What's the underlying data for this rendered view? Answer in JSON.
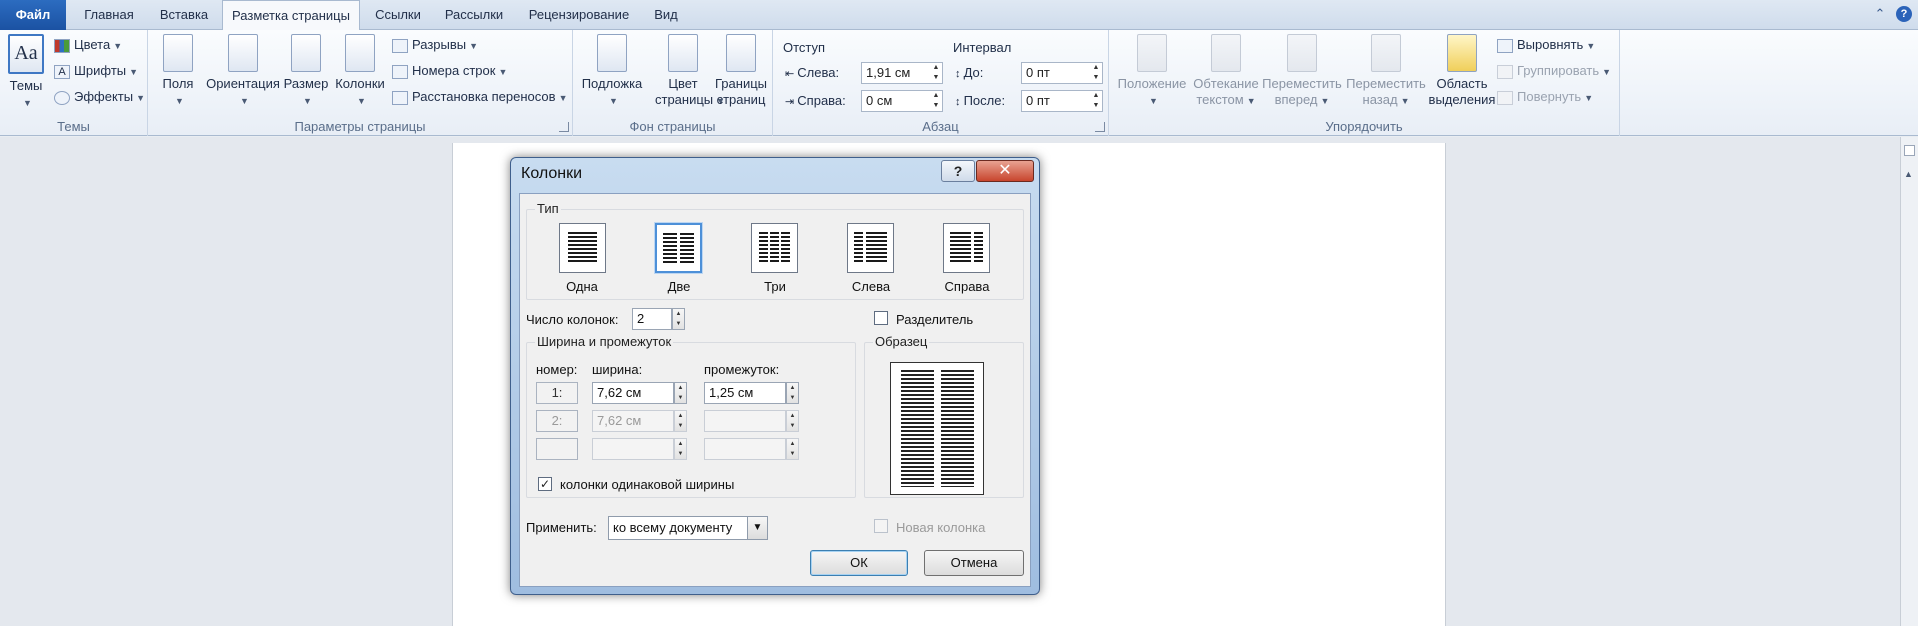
{
  "tabs": [
    {
      "label": "Файл"
    },
    {
      "label": "Главная"
    },
    {
      "label": "Вставка"
    },
    {
      "label": "Разметка страницы"
    },
    {
      "label": "Ссылки"
    },
    {
      "label": "Рассылки"
    },
    {
      "label": "Рецензирование"
    },
    {
      "label": "Вид"
    }
  ],
  "ribbon": {
    "themes": {
      "label": "Темы",
      "big": "Темы",
      "colors": "Цвета",
      "fonts": "Шрифты",
      "effects": "Эффекты"
    },
    "page_setup": {
      "label": "Параметры страницы",
      "margins": "Поля",
      "orientation": "Ориентация",
      "size": "Размер",
      "columns": "Колонки",
      "breaks": "Разрывы",
      "line_numbers": "Номера строк",
      "hyphenation": "Расстановка переносов"
    },
    "page_background": {
      "label": "Фон страницы",
      "watermark": "Подложка",
      "page_color_1": "Цвет",
      "page_color_2": "страницы",
      "borders_1": "Границы",
      "borders_2": "страниц"
    },
    "paragraph": {
      "label": "Абзац",
      "indent": "Отступ",
      "left_label": "Слева:",
      "left_value": "1,91 см",
      "right_label": "Справа:",
      "right_value": "0 см",
      "spacing": "Интервал",
      "before_label": "До:",
      "before_value": "0 пт",
      "after_label": "После:",
      "after_value": "0 пт"
    },
    "arrange": {
      "label": "Упорядочить",
      "position": "Положение",
      "wrap_1": "Обтекание",
      "wrap_2": "текстом",
      "forward_1": "Переместить",
      "forward_2": "вперед",
      "backward_1": "Переместить",
      "backward_2": "назад",
      "selection_1": "Область",
      "selection_2": "выделения",
      "align": "Выровнять",
      "group": "Группировать",
      "rotate": "Повернуть"
    }
  },
  "dialog": {
    "title": "Колонки",
    "help": "?",
    "close": "✕",
    "presets_legend": "Тип",
    "presets": [
      {
        "label": "Одна"
      },
      {
        "label": "Две"
      },
      {
        "label": "Три"
      },
      {
        "label": "Слева"
      },
      {
        "label": "Справа"
      }
    ],
    "num_columns_label": "Число колонок:",
    "num_columns_value": "2",
    "separator_label": "Разделитель",
    "width_spacing_legend": "Ширина и промежуток",
    "col_header_number": "номер:",
    "col_header_width": "ширина:",
    "col_header_spacing": "промежуток:",
    "rows": [
      {
        "number": "1:",
        "width": "7,62 см",
        "spacing": "1,25 см"
      },
      {
        "number": "2:",
        "width": "7,62 см",
        "spacing": ""
      },
      {
        "number": "",
        "width": "",
        "spacing": ""
      }
    ],
    "equal_width_label": "колонки одинаковой ширины",
    "preview_legend": "Образец",
    "apply_label": "Применить:",
    "apply_value": "ко всему документу",
    "new_column_label": "Новая колонка",
    "ok": "ОК",
    "cancel": "Отмена"
  }
}
